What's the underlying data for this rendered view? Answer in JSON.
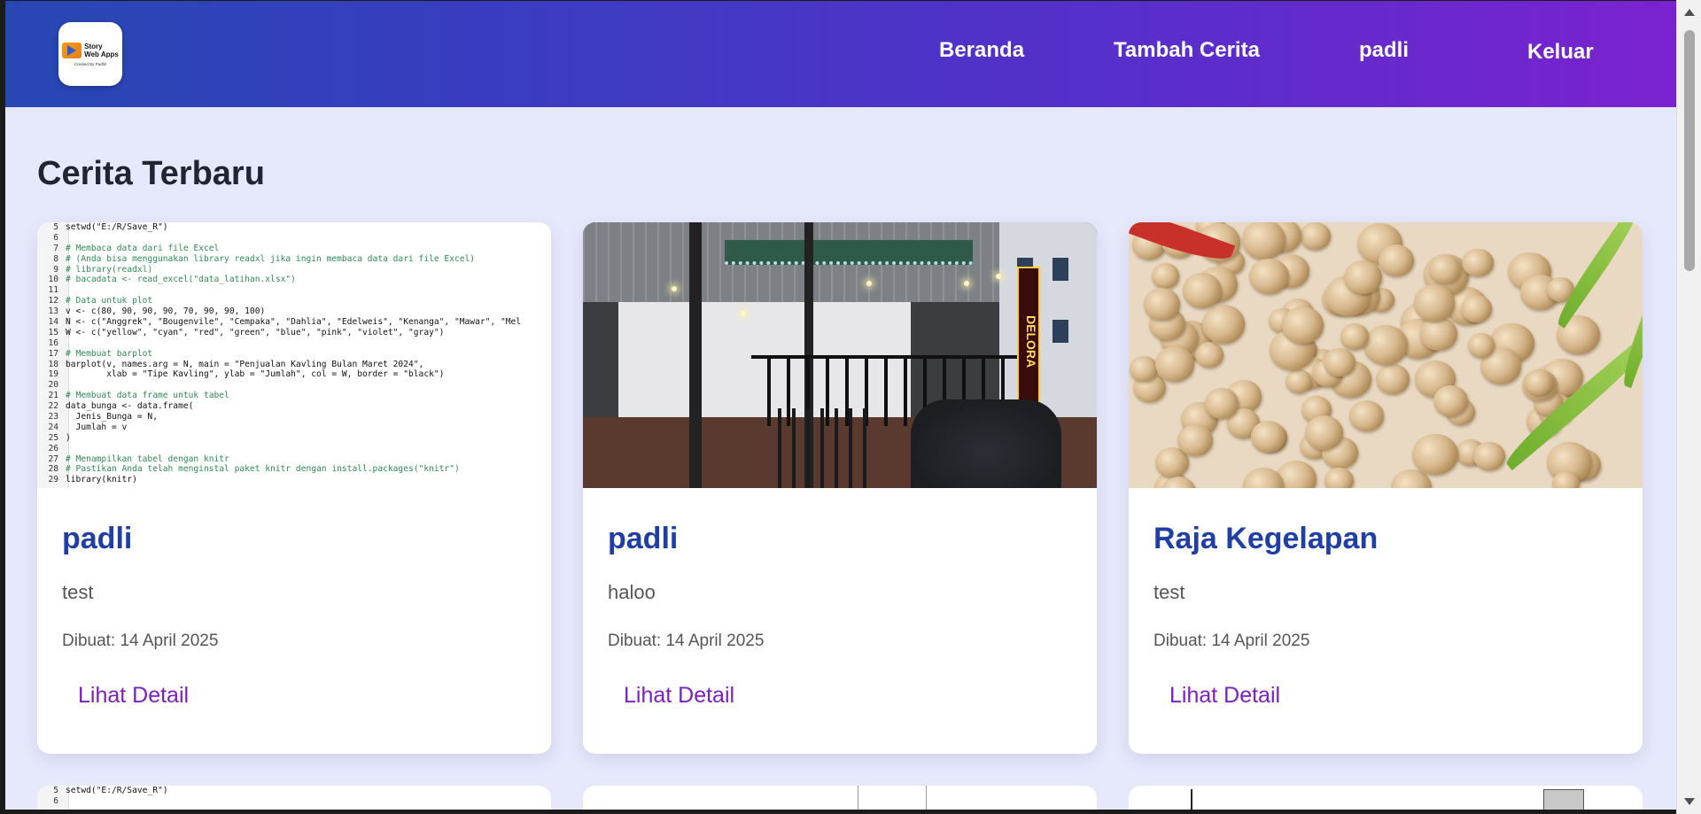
{
  "header": {
    "logo": {
      "line1": "Story",
      "line2": "Web Apps",
      "sub": "Created By Padhil"
    },
    "nav": [
      "Beranda",
      "Tambah Cerita",
      "padli",
      "Keluar"
    ]
  },
  "main": {
    "title": "Cerita Terbaru",
    "cards": [
      {
        "title": "padli",
        "desc": "test",
        "date": "Dibuat: 14 April 2025",
        "link": "Lihat Detail"
      },
      {
        "title": "padli",
        "desc": "haloo",
        "date": "Dibuat: 14 April 2025",
        "link": "Lihat Detail"
      },
      {
        "title": "Raja Kegelapan",
        "desc": "test",
        "date": "Dibuat: 14 April 2025",
        "link": "Lihat Detail"
      }
    ],
    "code_lines": [
      {
        "n": "5",
        "t": "setwd(\"E:/R/Save_R\")"
      },
      {
        "n": "6",
        "t": ""
      },
      {
        "n": "7",
        "t": "# Membaca data dari file Excel"
      },
      {
        "n": "8",
        "t": "# (Anda bisa menggunakan library readxl jika ingin membaca data dari file Excel)"
      },
      {
        "n": "9",
        "t": "# library(readxl)"
      },
      {
        "n": "10",
        "t": "# bacadata <- read_excel(\"data_latihan.xlsx\")"
      },
      {
        "n": "11",
        "t": ""
      },
      {
        "n": "12",
        "t": "# Data untuk plot"
      },
      {
        "n": "13",
        "t": "v <- c(80, 90, 90, 90, 70, 90, 90, 100)"
      },
      {
        "n": "14",
        "t": "N <- c(\"Anggrek\", \"Bougenvile\", \"Cempaka\", \"Dahlia\", \"Edelweis\", \"Kenanga\", \"Mawar\", \"Mel"
      },
      {
        "n": "15",
        "t": "W <- c(\"yellow\", \"cyan\", \"red\", \"green\", \"blue\", \"pink\", \"violet\", \"gray\")"
      },
      {
        "n": "16",
        "t": ""
      },
      {
        "n": "17",
        "t": "# Membuat barplot"
      },
      {
        "n": "18",
        "t": "barplot(v, names.arg = N, main = \"Penjualan Kavling Bulan Maret 2024\","
      },
      {
        "n": "19",
        "t": "        xlab = \"Tipe Kavling\", ylab = \"Jumlah\", col = W, border = \"black\")"
      },
      {
        "n": "20",
        "t": ""
      },
      {
        "n": "21",
        "t": "# Membuat data frame untuk tabel"
      },
      {
        "n": "22",
        "t": "data_bunga <- data.frame("
      },
      {
        "n": "23",
        "t": "  Jenis_Bunga = N,"
      },
      {
        "n": "24",
        "t": "  Jumlah = v"
      },
      {
        "n": "25",
        "t": ")"
      },
      {
        "n": "26",
        "t": ""
      },
      {
        "n": "27",
        "t": "# Menampilkan tabel dengan knitr"
      },
      {
        "n": "28",
        "t": "# Pastikan Anda telah menginstal paket knitr dengan install.packages(\"knitr\")"
      },
      {
        "n": "29",
        "t": "library(knitr)"
      }
    ],
    "sign_text": "DELORA",
    "peek_code": [
      {
        "n": "5",
        "t": "setwd(\"E:/R/Save_R\")"
      },
      {
        "n": "6",
        "t": ""
      }
    ]
  },
  "colors": {
    "header_start": "#2747b3",
    "header_end": "#7a22cf",
    "title": "#1f3fa6",
    "link": "#7b1fc4",
    "page_bg": "#e6e8fb"
  }
}
